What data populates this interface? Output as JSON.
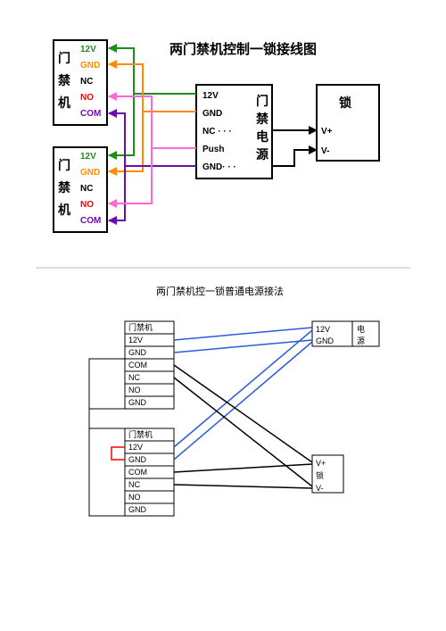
{
  "diagram1": {
    "title": "两门禁机控制一锁接线图",
    "access1": {
      "label": "门禁机",
      "pins": [
        "12V",
        "GND",
        "NC",
        "NO",
        "COM"
      ]
    },
    "access2": {
      "label": "门禁机",
      "pins": [
        "12V",
        "GND",
        "NC",
        "NO",
        "COM"
      ]
    },
    "psu": {
      "label": "门禁电源",
      "pins": [
        "12V",
        "GND",
        "NC · · ·",
        "Push",
        "GND· · ·"
      ]
    },
    "lock": {
      "label": "锁",
      "pins": [
        "V+",
        "V-"
      ]
    },
    "colors": {
      "12v": "#1a8f1a",
      "gnd": "#ff8c00",
      "nc": "#000",
      "no": "#ff0000",
      "com": "#6a0dad",
      "push": "#ff69d6",
      "lock": "#000"
    }
  },
  "diagram2": {
    "title": "两门禁机控一锁普通电源接法",
    "access1": {
      "label": "门禁机",
      "pins": [
        "12V",
        "GND",
        "COM",
        "NC",
        "NO",
        "GND"
      ]
    },
    "access2": {
      "label": "门禁机",
      "pins": [
        "12V",
        "GND",
        "COM",
        "NC",
        "NO",
        "GND"
      ]
    },
    "psu": {
      "labels": [
        "12V",
        "GND"
      ],
      "side": "电源"
    },
    "lock": {
      "labels": [
        "V+",
        "V-"
      ],
      "side": "锁"
    }
  }
}
